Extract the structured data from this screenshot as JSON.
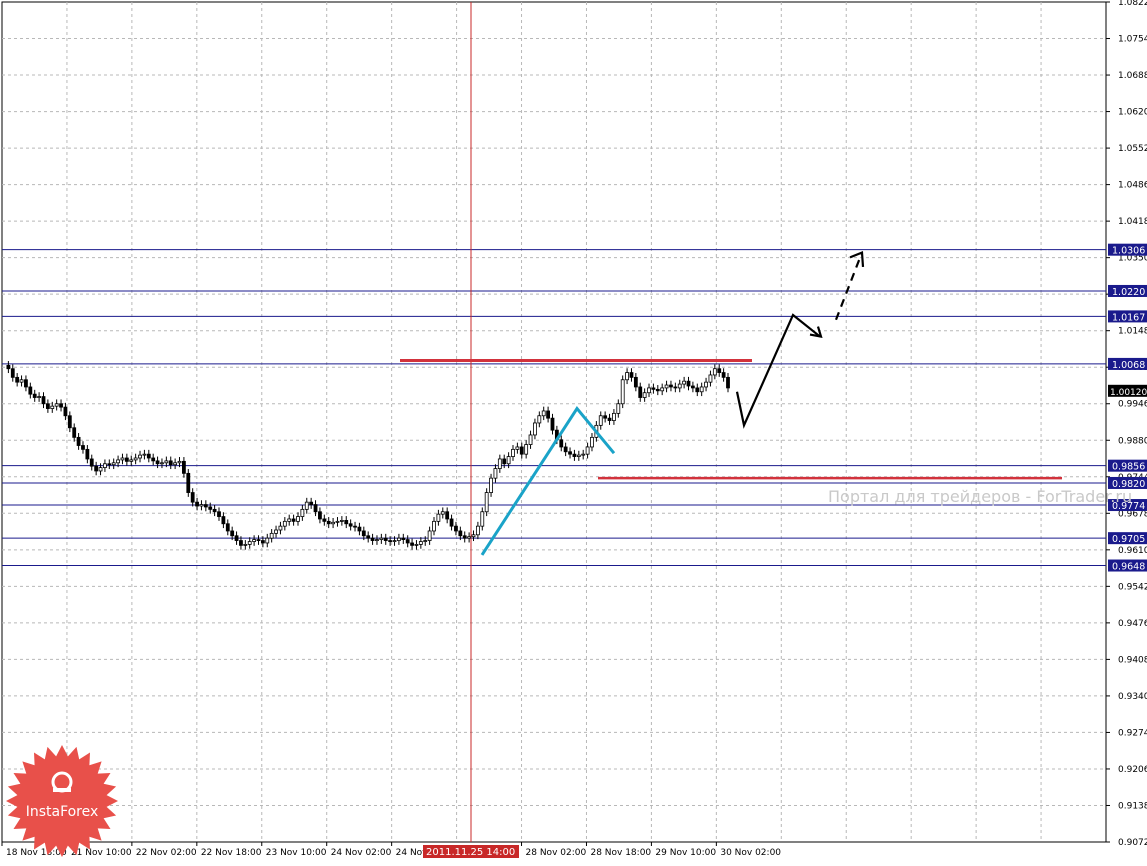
{
  "chart_data": {
    "type": "candlestick",
    "instrument_note": "",
    "ylim": [
      0.9072,
      1.0822
    ],
    "y_ticks": [
      "1.08220",
      "1.07540",
      "1.06880",
      "1.06200",
      "1.05520",
      "1.04860",
      "1.04180",
      "1.03500",
      "1.02840",
      "1.01480",
      "1.00820",
      "0.99460",
      "0.98800",
      "0.97440",
      "0.96780",
      "0.96100",
      "0.95420",
      "0.94760",
      "0.94080",
      "0.93400",
      "0.92740",
      "0.92060",
      "0.91380",
      "0.90720"
    ],
    "x_ticks": [
      "18 Nov 18:00",
      "21 Nov 10:00",
      "22 Nov 02:00",
      "22 Nov 18:00",
      "23 Nov 10:00",
      "24 Nov 02:00",
      "24 Nov",
      "28 Nov 02:00",
      "28 Nov 18:00",
      "29 Nov 10:00",
      "30 Nov 02:00"
    ],
    "crosshair_time_label": "2011.11.25 14:00",
    "current_price": "1.00120",
    "horizontal_levels": [
      {
        "label": "1.0306",
        "value": 1.0306
      },
      {
        "label": "1.0220",
        "value": 1.022
      },
      {
        "label": "1.0167",
        "value": 1.0167
      },
      {
        "label": "1.0068",
        "value": 1.0068
      },
      {
        "label": "0.9856",
        "value": 0.9856
      },
      {
        "label": "0.9820",
        "value": 0.982
      },
      {
        "label": "0.9774",
        "value": 0.9774
      },
      {
        "label": "0.9705",
        "value": 0.9705
      },
      {
        "label": "0.9648",
        "value": 0.9648
      }
    ],
    "price_path": [
      1.0065,
      1.0058,
      1.004,
      1.003,
      1.0035,
      1.002,
      1.0005,
      0.9998,
      1.0,
      0.9985,
      0.9975,
      0.998,
      0.9985,
      0.9978,
      0.996,
      0.9935,
      0.9915,
      0.9898,
      0.989,
      0.987,
      0.9855,
      0.9845,
      0.9852,
      0.986,
      0.9858,
      0.9862,
      0.9868,
      0.9872,
      0.9865,
      0.9868,
      0.9872,
      0.9878,
      0.988,
      0.9872,
      0.9866,
      0.986,
      0.9862,
      0.9866,
      0.9858,
      0.9862,
      0.9865,
      0.984,
      0.98,
      0.978,
      0.9772,
      0.9775,
      0.977,
      0.9765,
      0.976,
      0.975,
      0.9735,
      0.972,
      0.971,
      0.97,
      0.969,
      0.9692,
      0.9698,
      0.9702,
      0.97,
      0.9695,
      0.9705,
      0.9715,
      0.9722,
      0.973,
      0.974,
      0.9745,
      0.974,
      0.975,
      0.9765,
      0.978,
      0.9775,
      0.976,
      0.9745,
      0.974,
      0.9735,
      0.9738,
      0.974,
      0.9742,
      0.9735,
      0.973,
      0.9728,
      0.972,
      0.971,
      0.9705,
      0.97,
      0.9702,
      0.9705,
      0.97,
      0.9698,
      0.97,
      0.9705,
      0.9702,
      0.9695,
      0.969,
      0.9692,
      0.9698,
      0.97,
      0.972,
      0.974,
      0.9755,
      0.976,
      0.9745,
      0.973,
      0.972,
      0.971,
      0.9705,
      0.9708,
      0.9712,
      0.973,
      0.976,
      0.98,
      0.983,
      0.985,
      0.987,
      0.986,
      0.9875,
      0.989,
      0.9895,
      0.988,
      0.99,
      0.992,
      0.9945,
      0.996,
      0.997,
      0.9955,
      0.993,
      0.991,
      0.9895,
      0.9885,
      0.988,
      0.9875,
      0.9878,
      0.988,
      0.9895,
      0.9915,
      0.994,
      0.996,
      0.9955,
      0.995,
      0.9965,
      0.9985,
      1.0035,
      1.005,
      1.004,
      1.002,
      0.9998,
      1.0008,
      1.0018,
      1.0015,
      1.0012,
      1.0018,
      1.0024,
      1.002,
      1.0018,
      1.0026,
      1.0032,
      1.0022,
      1.0018,
      1.001,
      1.002,
      1.003,
      1.0045,
      1.0058,
      1.005,
      1.004,
      1.0018
    ],
    "annotations": {
      "resistance_red": {
        "value": 1.0075,
        "color": "#d2323c"
      },
      "support_red": {
        "value": 0.983,
        "color": "#d2323c"
      },
      "cyan_zigzag": [
        [
          0.967
        ],
        [
          0.9975
        ],
        [
          0.9882
        ]
      ],
      "forecast_arrow": [
        1.001,
        0.994,
        1.017,
        1.0125,
        1.03
      ]
    },
    "grid": true,
    "colors": {
      "level_line": "#1a1a8c",
      "crosshair": "#c82828",
      "cyan": "#1aa3c8",
      "label_bg": "#1a1a8c",
      "current_bg": "#000000"
    }
  },
  "watermark": "Портал для трейдеров - ForTrader.ru",
  "logo": {
    "text": "InstaForex",
    "color": "#e8504a"
  }
}
